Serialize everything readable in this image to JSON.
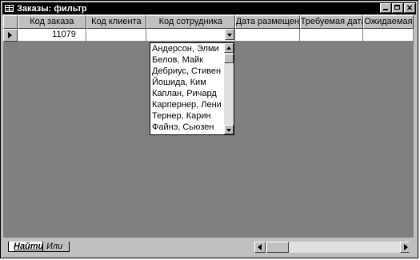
{
  "window": {
    "title": "Заказы: фильтр",
    "minimize_icon": "minimize-icon",
    "maximize_icon": "maximize-icon",
    "close_icon": "close-icon"
  },
  "grid": {
    "columns": [
      "Код заказа",
      "Код клиента",
      "Код сотрудника",
      "Дата размещения",
      "Требуемая дата",
      "Ожидаемая"
    ],
    "row": {
      "order_code": "11079",
      "client_code": "",
      "employee_code": "",
      "placed_date": "",
      "required_date": "",
      "expected": ""
    }
  },
  "dropdown": {
    "items": [
      "Андерсон, Элми",
      "Белов, Майк",
      "Дебриус, Стивен",
      "Йошида, Ким",
      "Каплан, Ричард",
      "Карпернер, Лени",
      "Тернер, Карин",
      "Файнэ, Сьюзен"
    ]
  },
  "tabs": [
    "Найти",
    "Или"
  ]
}
